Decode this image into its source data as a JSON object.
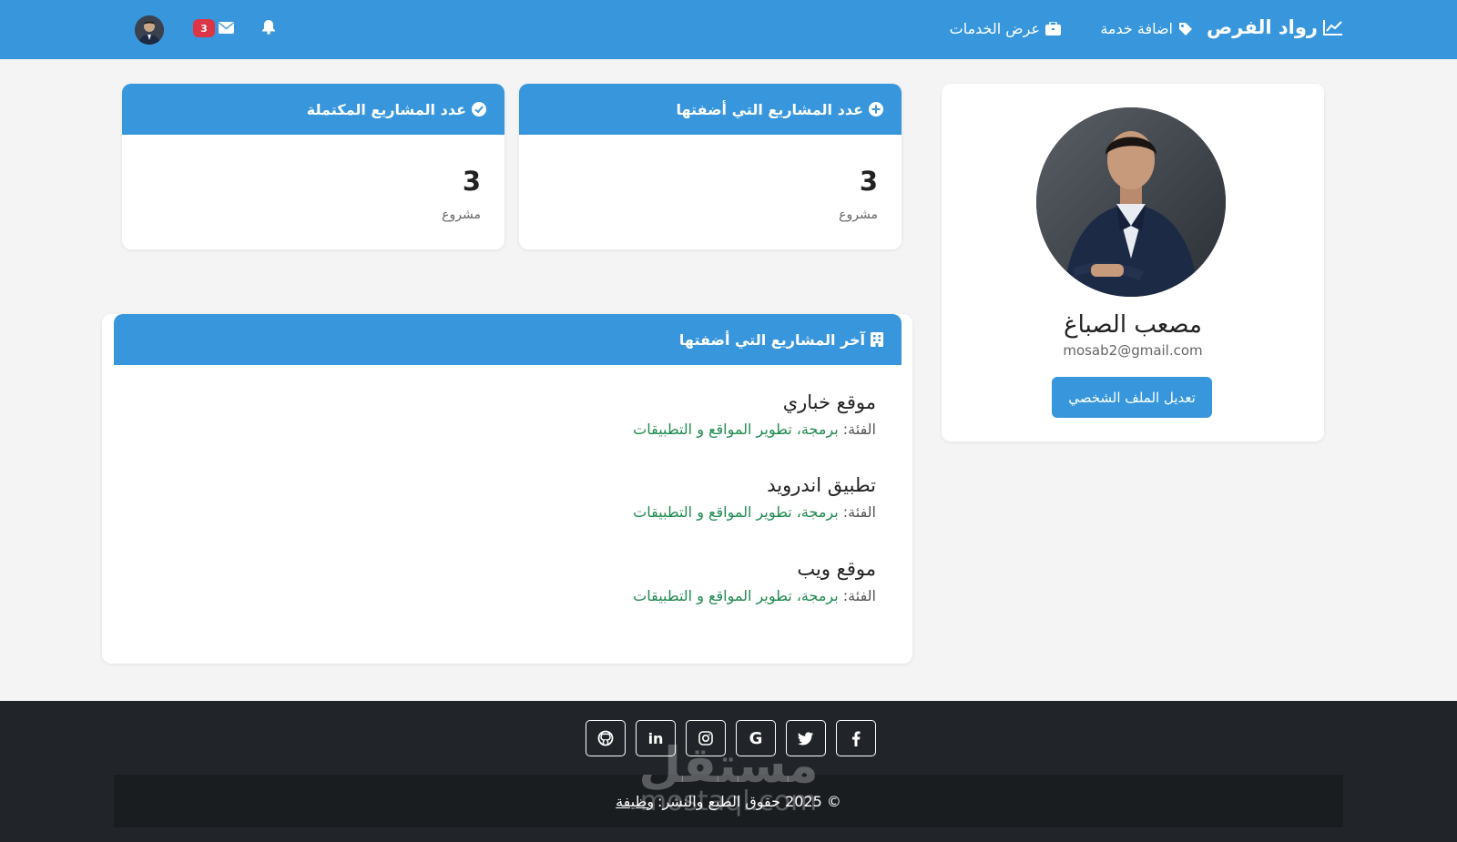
{
  "navbar": {
    "brand": "رواد الفرص",
    "add_service": "اضافة خدمة",
    "view_services": "عرض الخدمات",
    "mail_count": "3",
    "icons": [
      "chart-line-icon",
      "tag-icon",
      "briefcase-icon",
      "bell-icon",
      "envelope-icon"
    ],
    "color": "#3896dc"
  },
  "profile": {
    "name": "مصعب الصباغ",
    "email": "mosab2@gmail.com",
    "edit_button": "تعديل الملف الشخصي"
  },
  "stats": [
    {
      "title": "عدد المشاريع التي أضفتها",
      "value": "3",
      "unit": "مشروع",
      "icon": "plus-circle-icon"
    },
    {
      "title": "عدد المشاريع المكتملة",
      "value": "3",
      "unit": "مشروع",
      "icon": "check-circle-icon"
    }
  ],
  "latest": {
    "title": "آخر المشاريع التي أضفتها",
    "icon": "building-icon",
    "category_label": "الفئة:",
    "projects": [
      {
        "title": "موقع خباري",
        "category": "برمجة، تطوير المواقع و التطبيقات"
      },
      {
        "title": "تطبيق اندرويد",
        "category": "برمجة، تطوير المواقع و التطبيقات"
      },
      {
        "title": "موقع ويب",
        "category": "برمجة، تطوير المواقع و التطبيقات"
      }
    ]
  },
  "footer": {
    "socials": [
      "github-icon",
      "linkedin-icon",
      "instagram-icon",
      "google-icon",
      "twitter-icon",
      "facebook-icon"
    ],
    "copyright": "© 2025 حقوق الطبع والنشر:",
    "link": "وظيفة",
    "watermark_ar": "مستقل",
    "watermark_en": "mostaql.com"
  }
}
